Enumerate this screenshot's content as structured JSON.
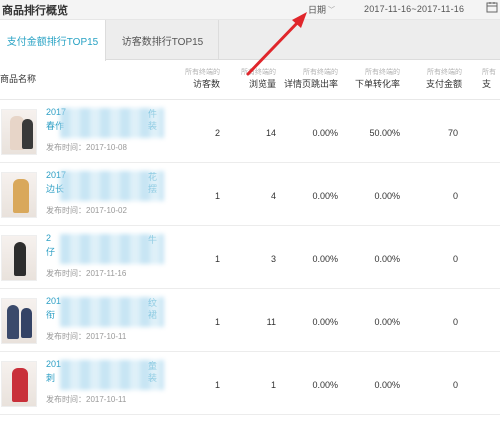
{
  "header": {
    "title": "商品排行概览",
    "date_label": "日期",
    "date_range": "2017-11-16~2017-11-16"
  },
  "tabs": [
    {
      "label": "支付金额排行TOP15",
      "active": true
    },
    {
      "label": "访客数排行TOP15",
      "active": false
    }
  ],
  "columns": {
    "product": "商品名称",
    "visitors": {
      "sub": "所有终端的",
      "main": "访客数"
    },
    "pageviews": {
      "sub": "所有终端的",
      "main": "浏览量"
    },
    "bounce": {
      "sub": "所有终端的",
      "main": "详情页跳出率"
    },
    "conversion": {
      "sub": "所有终端的",
      "main": "下单转化率"
    },
    "amount": {
      "sub": "所有终端的",
      "main": "支付金额"
    },
    "extra": {
      "sub": "所有",
      "main": "支"
    }
  },
  "rows": [
    {
      "title_a": "2017",
      "title_a_tail": "件",
      "title_b": "春作",
      "title_b_tail": "装",
      "date": "发布时间：2017-10-08",
      "visitors": "2",
      "pageviews": "14",
      "bounce": "0.00%",
      "conversion": "50.00%",
      "amount": "70"
    },
    {
      "title_a": "2017",
      "title_a_tail": "花",
      "title_b": "边长",
      "title_b_tail": "摆",
      "date": "发布时间：2017-10-02",
      "visitors": "1",
      "pageviews": "4",
      "bounce": "0.00%",
      "conversion": "0.00%",
      "amount": "0"
    },
    {
      "title_a": "2",
      "title_a_tail": "牛",
      "title_b": "仔",
      "title_b_tail": "",
      "date": "发布时间：2017-11-16",
      "visitors": "1",
      "pageviews": "3",
      "bounce": "0.00%",
      "conversion": "0.00%",
      "amount": "0"
    },
    {
      "title_a": "201",
      "title_a_tail": "纹",
      "title_b": "衔",
      "title_b_tail": "裙",
      "date": "发布时间：2017-10-11",
      "visitors": "1",
      "pageviews": "11",
      "bounce": "0.00%",
      "conversion": "0.00%",
      "amount": "0"
    },
    {
      "title_a": "201",
      "title_a_tail": "童",
      "title_b": "刺",
      "title_b_tail": "装",
      "date": "发布时间：2017-10-11",
      "visitors": "1",
      "pageviews": "1",
      "bounce": "0.00%",
      "conversion": "0.00%",
      "amount": "0"
    }
  ],
  "colors": {
    "accent": "#27a2c4",
    "link": "#2b9ec4",
    "arrow": "#e0262b"
  }
}
